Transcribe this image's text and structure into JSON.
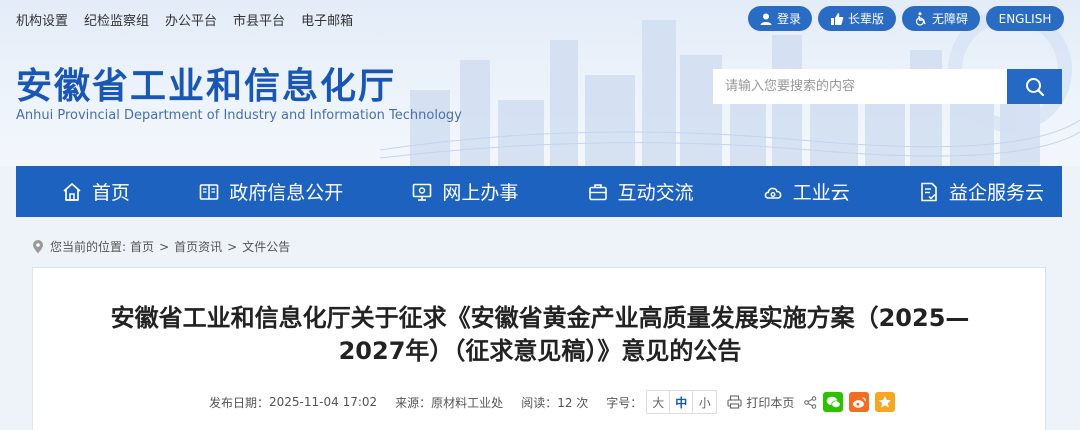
{
  "top_links": [
    "机构设置",
    "纪检监察组",
    "办公平台",
    "市县平台",
    "电子邮箱"
  ],
  "top_buttons": {
    "login": "登录",
    "elder": "长辈版",
    "accessible": "无障碍",
    "english": "ENGLISH"
  },
  "site": {
    "title": "安徽省工业和信息化厅",
    "subtitle": "Anhui Provincial Department of Industry and Information Technology"
  },
  "search": {
    "placeholder": "请输入您要搜索的内容"
  },
  "nav": [
    "首页",
    "政府信息公开",
    "网上办事",
    "互动交流",
    "工业云",
    "益企服务云"
  ],
  "breadcrumb": {
    "label": "您当前的位置:",
    "items": [
      "首页",
      "首页资讯",
      "文件公告"
    ],
    "separator": ">"
  },
  "article": {
    "title_line1": "安徽省工业和信息化厅关于征求《安徽省黄金产业高质量发展实施方案（2025—",
    "title_line2": "2027年）（征求意见稿）》意见的公告",
    "date_label": "发布日期：",
    "date_value": "2025-11-04 17:02",
    "source_label": "来源：",
    "source_value": "原材料工业处",
    "reads_label": "阅读：",
    "reads_value": "12 次",
    "fontsize_label": "字号：",
    "font_sizes": [
      "大",
      "中",
      "小"
    ],
    "print_label": "打印本页"
  },
  "colors": {
    "brand_blue": "#1d62bf",
    "title_blue": "#1a57b5",
    "wechat_green": "#2dc100",
    "weibo_orange": "#f26d21",
    "favorite_orange": "#f5a623"
  }
}
